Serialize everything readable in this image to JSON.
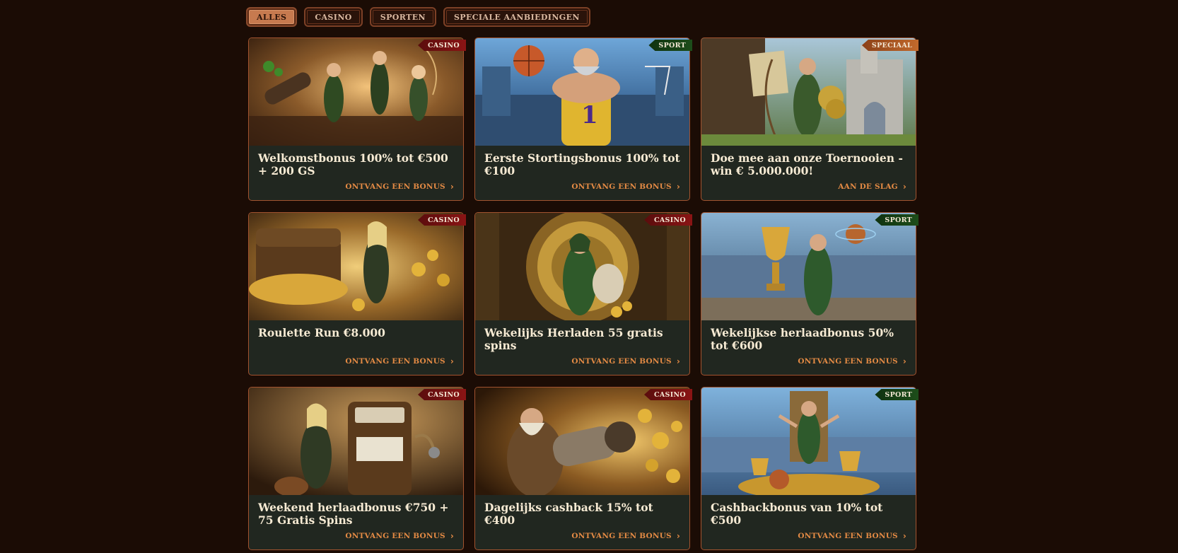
{
  "filters": [
    {
      "label": "ALLES",
      "active": true
    },
    {
      "label": "CASINO",
      "active": false
    },
    {
      "label": "SPORTEN",
      "active": false
    },
    {
      "label": "SPECIALE AANBIEDINGEN",
      "active": false
    }
  ],
  "cards": [
    {
      "tag": "CASINO",
      "title": "Welkomstbonus 100% tot €500 + 200 GS",
      "cta": "ONTVANG EEN BONUS",
      "image": "robin-hood-band-cannon"
    },
    {
      "tag": "SPORT",
      "title": "Eerste Stortingsbonus 100% tot €100",
      "cta": "ONTVANG EEN BONUS",
      "image": "basketball-player-arena"
    },
    {
      "tag": "SPECIAAL",
      "title": "Doe mee aan onze Toernooien - win € 5.000.000!",
      "cta": "AAN DE SLAG",
      "image": "archer-castle-gold"
    },
    {
      "tag": "CASINO",
      "title": "Roulette Run €8.000",
      "cta": "ONTVANG EEN BONUS",
      "image": "treasure-chest-gold-coins"
    },
    {
      "tag": "CASINO",
      "title": "Wekelijks Herladen 55 gratis spins",
      "cta": "ONTVANG EEN BONUS",
      "image": "vault-money-bag"
    },
    {
      "tag": "SPORT",
      "title": "Wekelijkse herlaadbonus 50% tot €600",
      "cta": "ONTVANG EEN BONUS",
      "image": "trophy-stadium"
    },
    {
      "tag": "CASINO",
      "title": "Weekend herlaadbonus €750 + 75 Gratis Spins",
      "cta": "ONTVANG EEN BONUS",
      "image": "slot-machine-archer"
    },
    {
      "tag": "CASINO",
      "title": "Dagelijks cashback 15% tot €400",
      "cta": "ONTVANG EEN BONUS",
      "image": "coin-cannon-dwarf"
    },
    {
      "tag": "SPORT",
      "title": "Cashbackbonus van 10% tot €500",
      "cta": "ONTVANG EEN BONUS",
      "image": "throne-trophies-stadium"
    }
  ],
  "colors": {
    "background": "#1b0c05",
    "card_body": "#212720",
    "card_border": "#a2532f",
    "cta": "#e38a44",
    "ribbon_casino": "#8a1414",
    "ribbon_sport": "#1d4d1a",
    "ribbon_speciaal": "#c26a2c"
  }
}
